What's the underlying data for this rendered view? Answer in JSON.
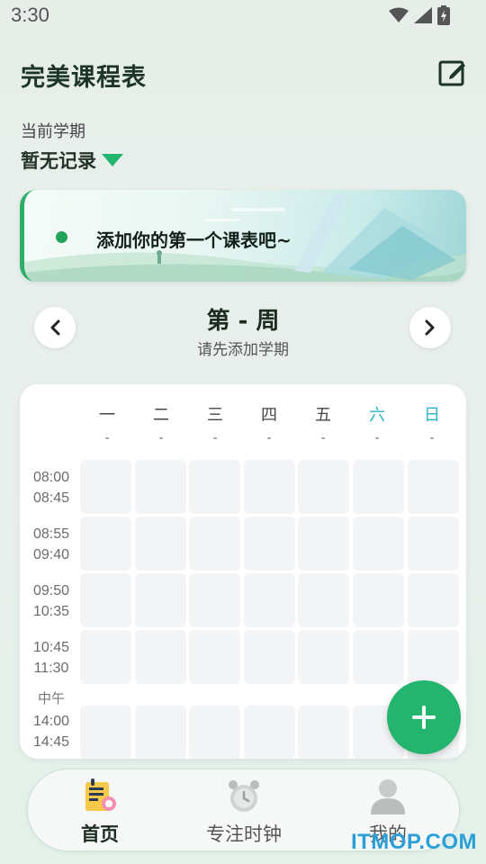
{
  "status_bar": {
    "time": "3:30"
  },
  "header": {
    "title": "完美课程表"
  },
  "term": {
    "label": "当前学期",
    "value": "暂无记录"
  },
  "banner": {
    "text": "添加你的第一个课表吧~"
  },
  "week": {
    "title": "第 - 周",
    "subtitle": "请先添加学期"
  },
  "timetable": {
    "days": [
      {
        "name": "一",
        "date": "-"
      },
      {
        "name": "二",
        "date": "-"
      },
      {
        "name": "三",
        "date": "-"
      },
      {
        "name": "四",
        "date": "-"
      },
      {
        "name": "五",
        "date": "-"
      },
      {
        "name": "六",
        "date": "-"
      },
      {
        "name": "日",
        "date": "-"
      }
    ],
    "slots": [
      {
        "start": "08:00",
        "end": "08:45"
      },
      {
        "start": "08:55",
        "end": "09:40"
      },
      {
        "start": "09:50",
        "end": "10:35"
      },
      {
        "start": "10:45",
        "end": "11:30"
      },
      {
        "start": "14:00",
        "end": "14:45"
      }
    ],
    "noon_label": "中午"
  },
  "bottom_nav": {
    "items": [
      {
        "label": "首页",
        "icon": "home-schedule-icon",
        "active": true
      },
      {
        "label": "专注时钟",
        "icon": "alarm-clock-icon",
        "active": false
      },
      {
        "label": "我的",
        "icon": "profile-icon",
        "active": false
      }
    ]
  },
  "watermark": "ITMOP.COM",
  "colors": {
    "accent": "#23b46d",
    "weekend": "#2ab5c0",
    "cell": "#f3f4f6"
  }
}
